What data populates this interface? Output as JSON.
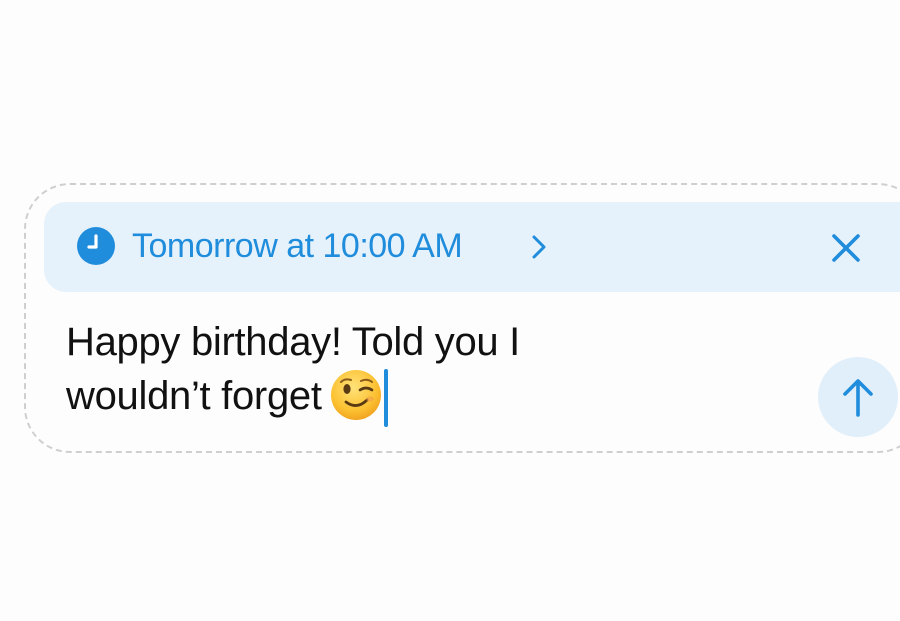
{
  "schedule": {
    "label": "Tomorrow at 10:00 AM",
    "icon": "clock-icon",
    "chevron_icon": "chevron-right-icon",
    "close_icon": "close-icon",
    "accent_color": "#1f8cdc",
    "background_color": "#e6f2fb"
  },
  "message": {
    "line1": "Happy birthday! Told you I",
    "line2": "wouldn’t forget",
    "emoji": "winking-face-emoji"
  },
  "send": {
    "icon": "arrow-up-icon",
    "background_color": "#e1effa"
  }
}
